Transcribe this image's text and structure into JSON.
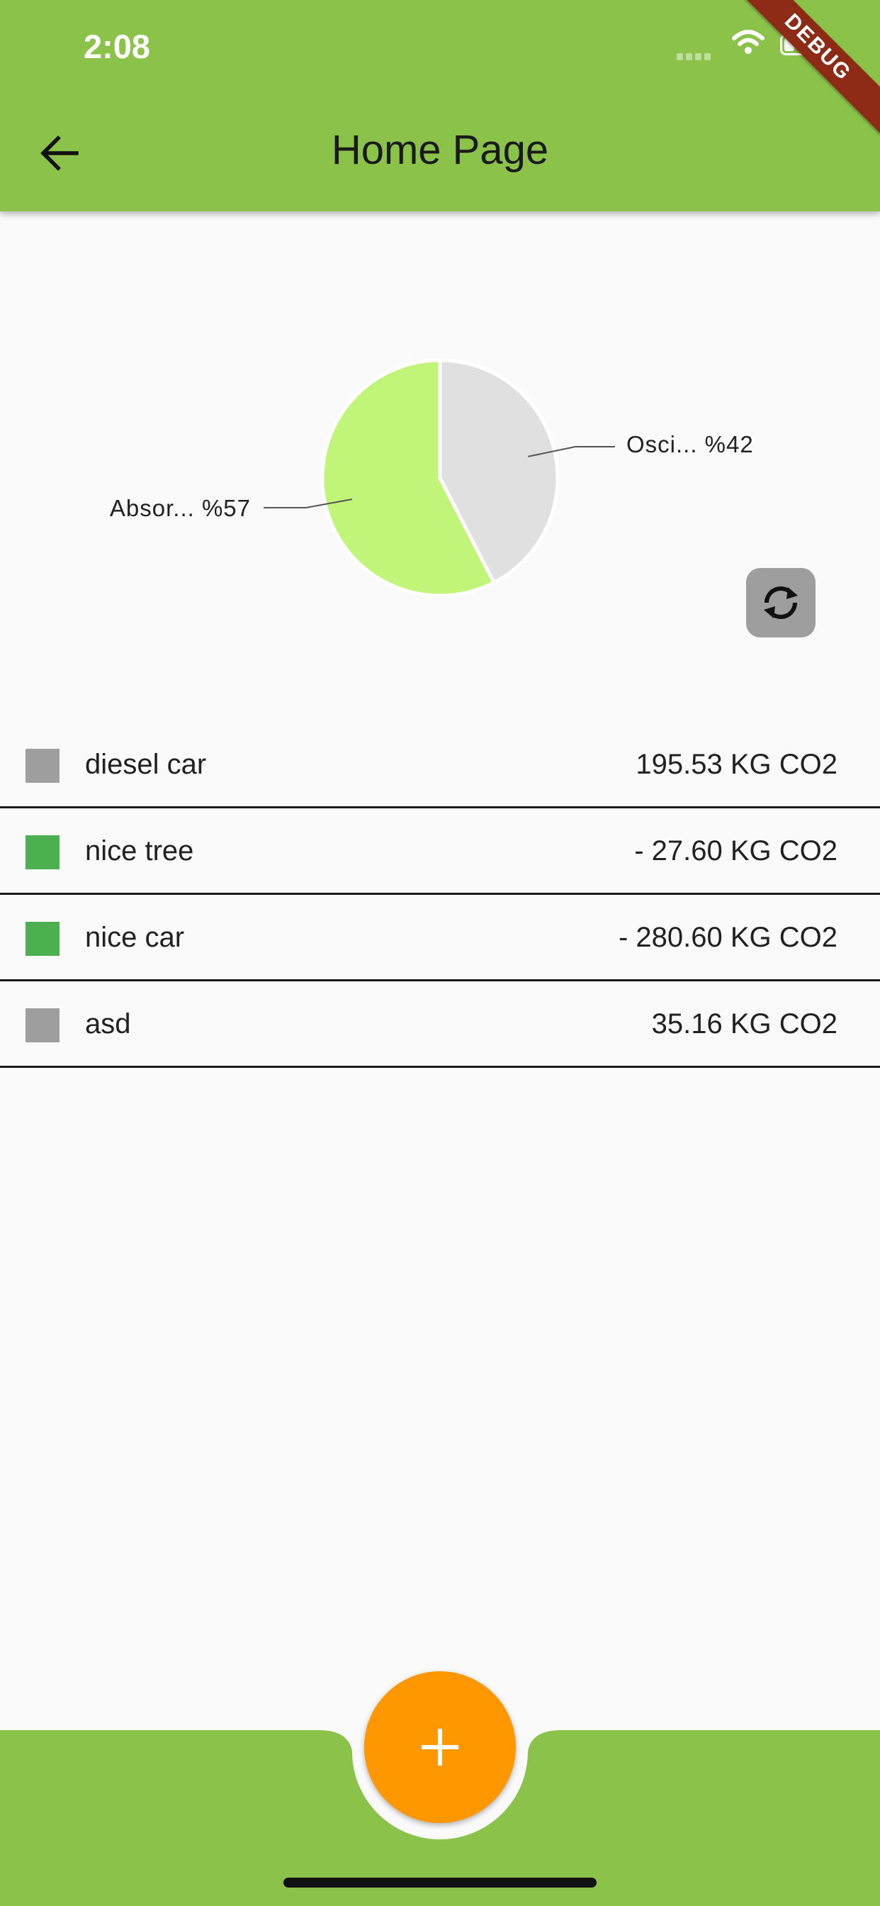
{
  "status_bar": {
    "time": "2:08"
  },
  "debug_banner": "DEBUG",
  "app_bar": {
    "title": "Home Page",
    "back_icon": "arrow-back-icon"
  },
  "colors": {
    "primary": "#8bc34a",
    "fab": "#ff9800",
    "absorb_slice": "#c0f57a",
    "emit_slice": "#e0e0e0",
    "swatch_emit": "#9e9e9e",
    "swatch_absorb": "#4caf50"
  },
  "chart_data": {
    "type": "pie",
    "slices": [
      {
        "label": "Osci... %42",
        "value": 42,
        "color": "#e0e0e0"
      },
      {
        "label": "Absor... %57",
        "value": 57,
        "color": "#c0f57a"
      }
    ]
  },
  "refresh_icon": "sync-icon",
  "entries": [
    {
      "name": "diesel car",
      "value": "195.53 KG CO2",
      "swatch": "#9e9e9e"
    },
    {
      "name": "nice tree",
      "value": "- 27.60 KG CO2",
      "swatch": "#4caf50"
    },
    {
      "name": "nice car",
      "value": "- 280.60 KG CO2",
      "swatch": "#4caf50"
    },
    {
      "name": "asd",
      "value": "35.16 KG CO2",
      "swatch": "#9e9e9e"
    }
  ],
  "fab_icon": "plus-icon"
}
